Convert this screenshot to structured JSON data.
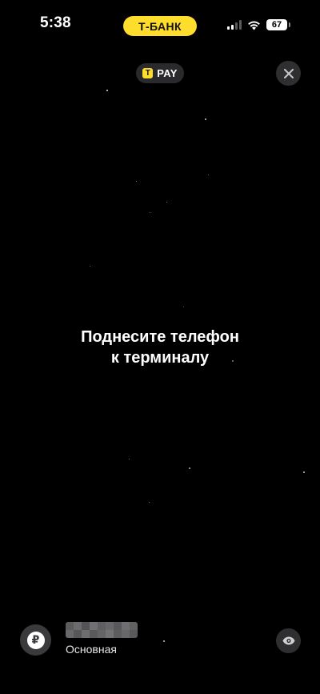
{
  "status_bar": {
    "time": "5:38",
    "carrier": "Т-БАНК",
    "battery": "67",
    "carrier_color": "#FFDD2D"
  },
  "pay_badge": {
    "label": "PAY",
    "logo_glyph": "T"
  },
  "close_button": {
    "icon": "close-icon"
  },
  "main": {
    "instruction_line1": "Поднесите телефон",
    "instruction_line2": "к терминалу"
  },
  "account": {
    "currency_symbol": "₽",
    "name": "Основная",
    "balance_hidden": true
  },
  "eye_button": {
    "icon": "eye-icon"
  }
}
